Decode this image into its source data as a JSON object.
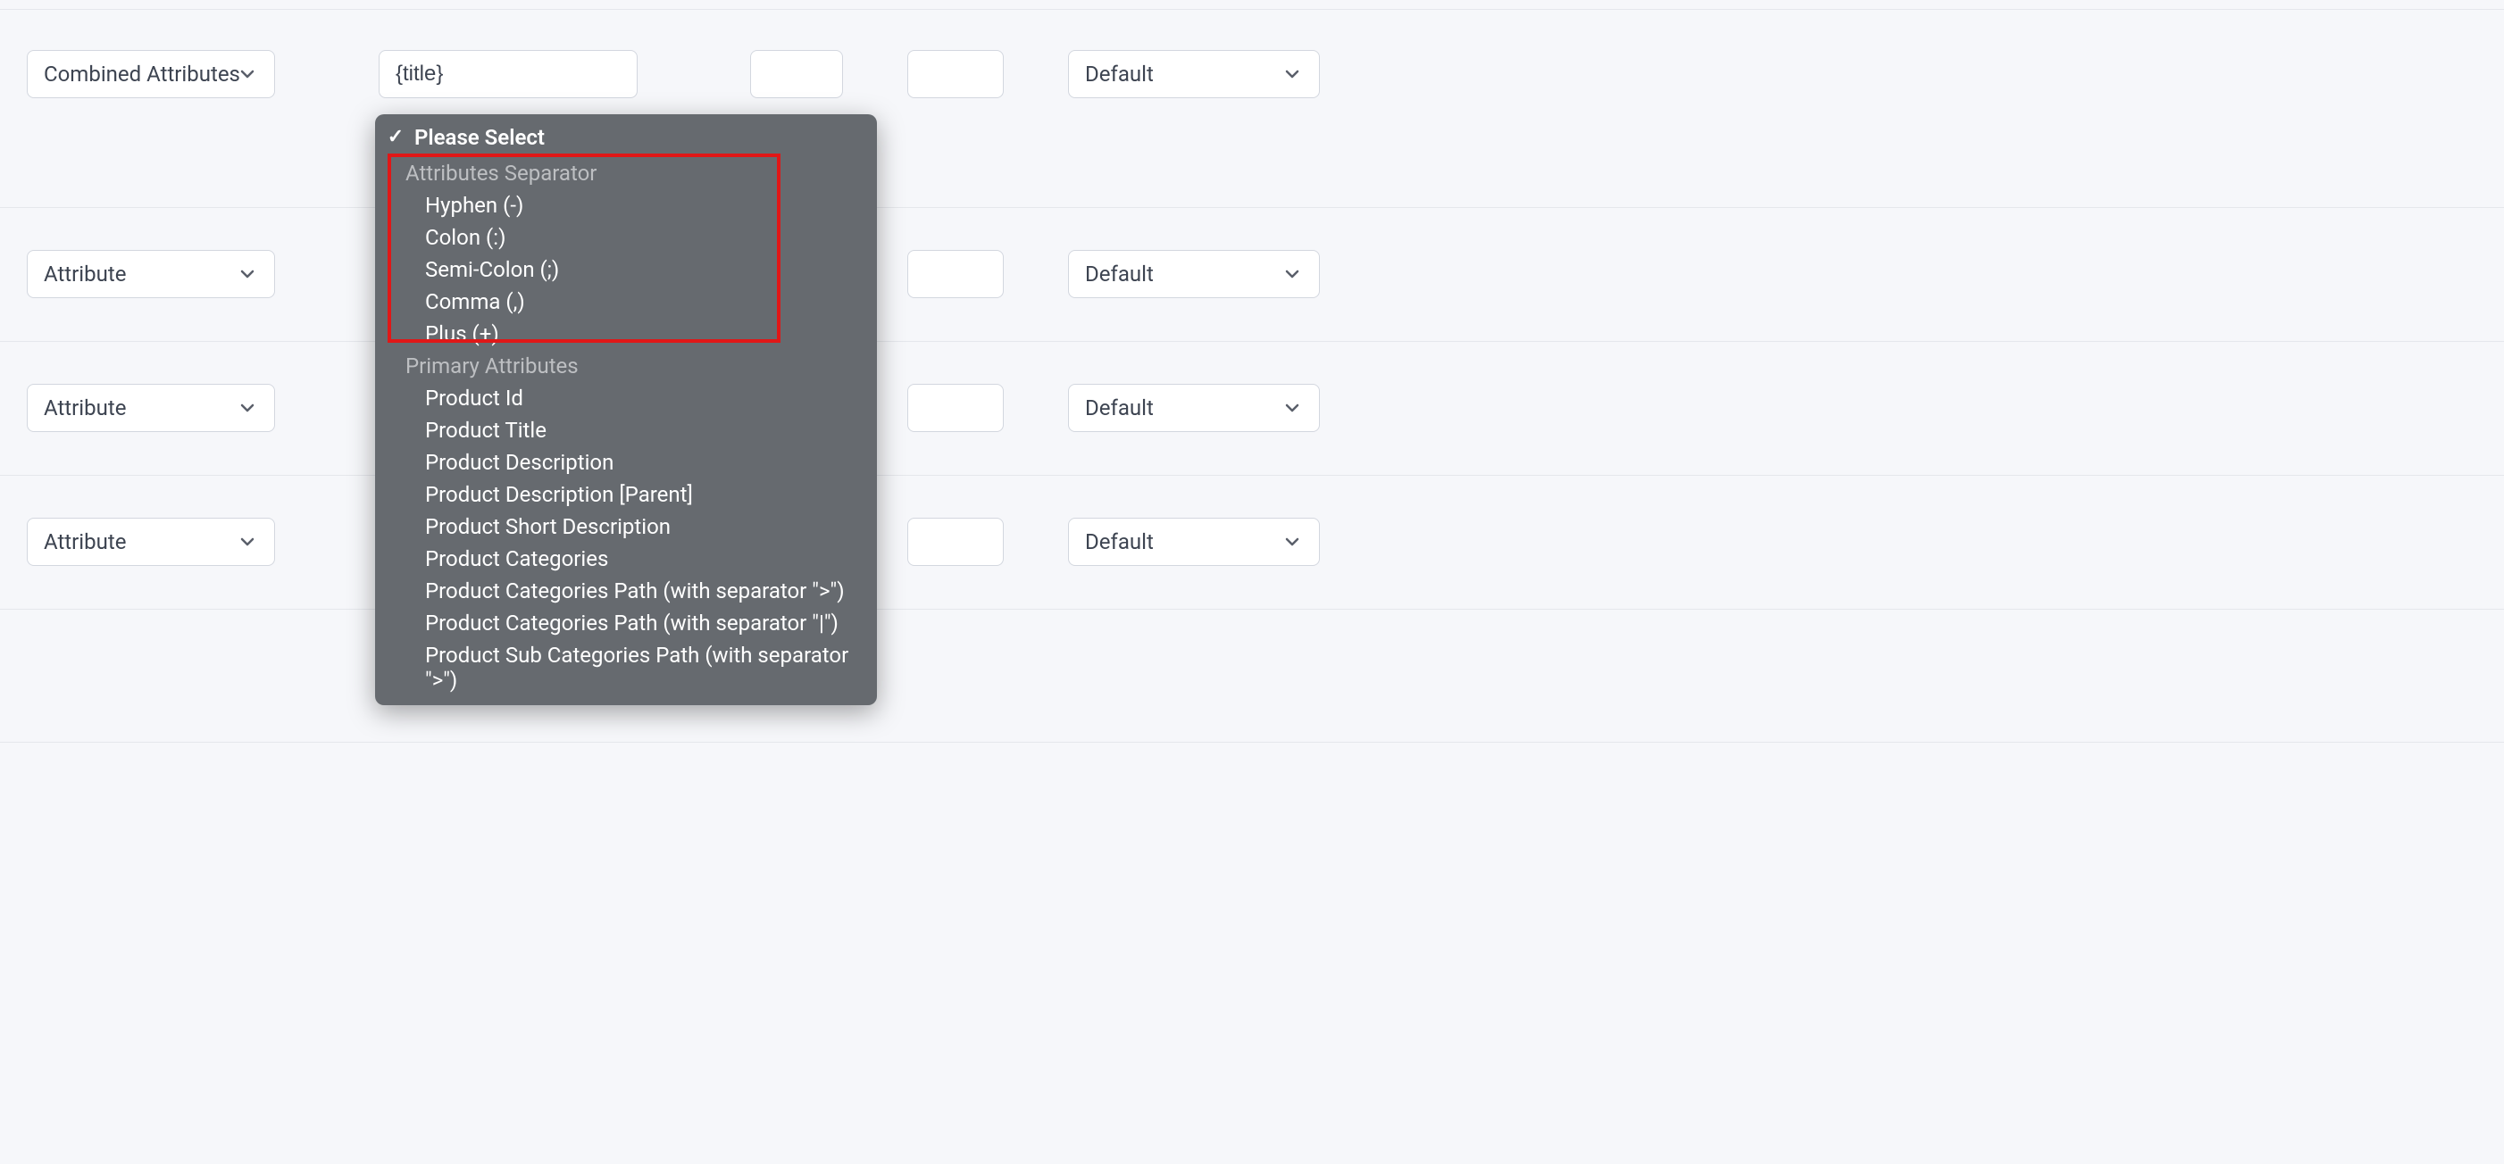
{
  "rows": [
    {
      "type_label": "Combined Attributes",
      "value": "{title}",
      "small_a": "",
      "small_b": "",
      "output_label": "Default"
    },
    {
      "type_label": "Attribute",
      "small_b": "",
      "output_label": "Default"
    },
    {
      "type_label": "Attribute",
      "small_b": "",
      "output_label": "Default"
    },
    {
      "type_label": "Attribute",
      "small_b": "",
      "output_label": "Default"
    }
  ],
  "dropdown": {
    "selected": "Please Select",
    "groups": [
      {
        "label": "Attributes Separator",
        "options": [
          "Hyphen (-)",
          "Colon (:)",
          "Semi-Colon (;)",
          "Comma (,)",
          "Plus (+)"
        ]
      },
      {
        "label": "Primary Attributes",
        "options": [
          "Product Id",
          "Product Title",
          "Product Description",
          "Product Description [Parent]",
          "Product Short Description",
          "Product Categories",
          "Product Categories Path (with separator \">\")",
          "Product Categories Path (with separator \"|\")",
          "Product Sub Categories Path (with separator \">\")"
        ]
      }
    ]
  }
}
